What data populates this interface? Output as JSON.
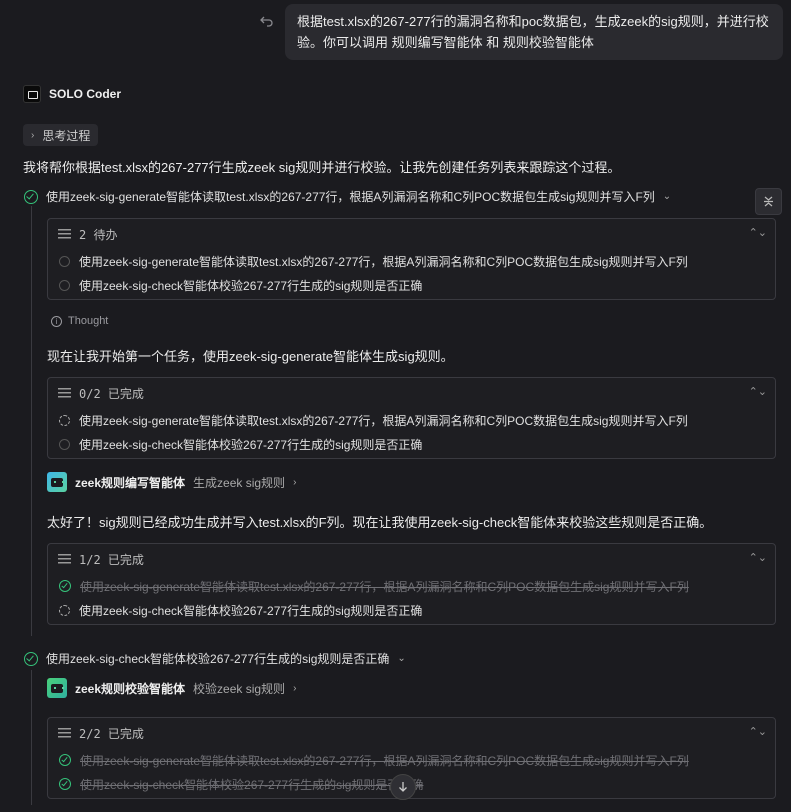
{
  "user_message": {
    "text": "根据test.xlsx的267-277行的漏洞名称和poc数据包，生成zeek的sig规则，并进行校验。你可以调用 规则编写智能体 和 规则校验智能体"
  },
  "header": {
    "name": "SOLO Coder"
  },
  "thinking_label": "思考过程",
  "intro_text": "我将帮你根据test.xlsx的267-277行生成zeek sig规则并进行校验。让我先创建任务列表来跟踪这个过程。",
  "task1": {
    "label": "使用zeek-sig-generate智能体读取test.xlsx的267-277行，根据A列漏洞名称和C列POC数据包生成sig规则并写入F列"
  },
  "task2": {
    "label": "使用zeek-sig-check智能体校验267-277行生成的sig规则是否正确"
  },
  "todo_boxes": [
    {
      "header": "2 待办",
      "items": [
        "使用zeek-sig-generate智能体读取test.xlsx的267-277行，根据A列漏洞名称和C列POC数据包生成sig规则并写入F列",
        "使用zeek-sig-check智能体校验267-277行生成的sig规则是否正确"
      ]
    },
    {
      "header": "0/2 已完成",
      "items": [
        "使用zeek-sig-generate智能体读取test.xlsx的267-277行，根据A列漏洞名称和C列POC数据包生成sig规则并写入F列",
        "使用zeek-sig-check智能体校验267-277行生成的sig规则是否正确"
      ]
    },
    {
      "header": "1/2 已完成",
      "items": [
        "使用zeek-sig-generate智能体读取test.xlsx的267-277行，根据A列漏洞名称和C列POC数据包生成sig规则并写入F列",
        "使用zeek-sig-check智能体校验267-277行生成的sig规则是否正确"
      ]
    },
    {
      "header": "2/2 已完成",
      "items": [
        "使用zeek-sig-generate智能体读取test.xlsx的267-277行，根据A列漏洞名称和C列POC数据包生成sig规则并写入F列",
        "使用zeek-sig-check智能体校验267-277行生成的sig规则是否正确"
      ]
    }
  ],
  "thought_label": "Thought",
  "msg_start": "现在让我开始第一个任务，使用zeek-sig-generate智能体生成sig规则。",
  "agent1": {
    "name": "zeek规则编写智能体",
    "action": "生成zeek sig规则"
  },
  "msg_done": "太好了！sig规则已经成功生成并写入test.xlsx的F列。现在让我使用zeek-sig-check智能体来校验这些规则是否正确。",
  "agent2": {
    "name": "zeek规则校验智能体",
    "action": "校验zeek sig规则"
  }
}
